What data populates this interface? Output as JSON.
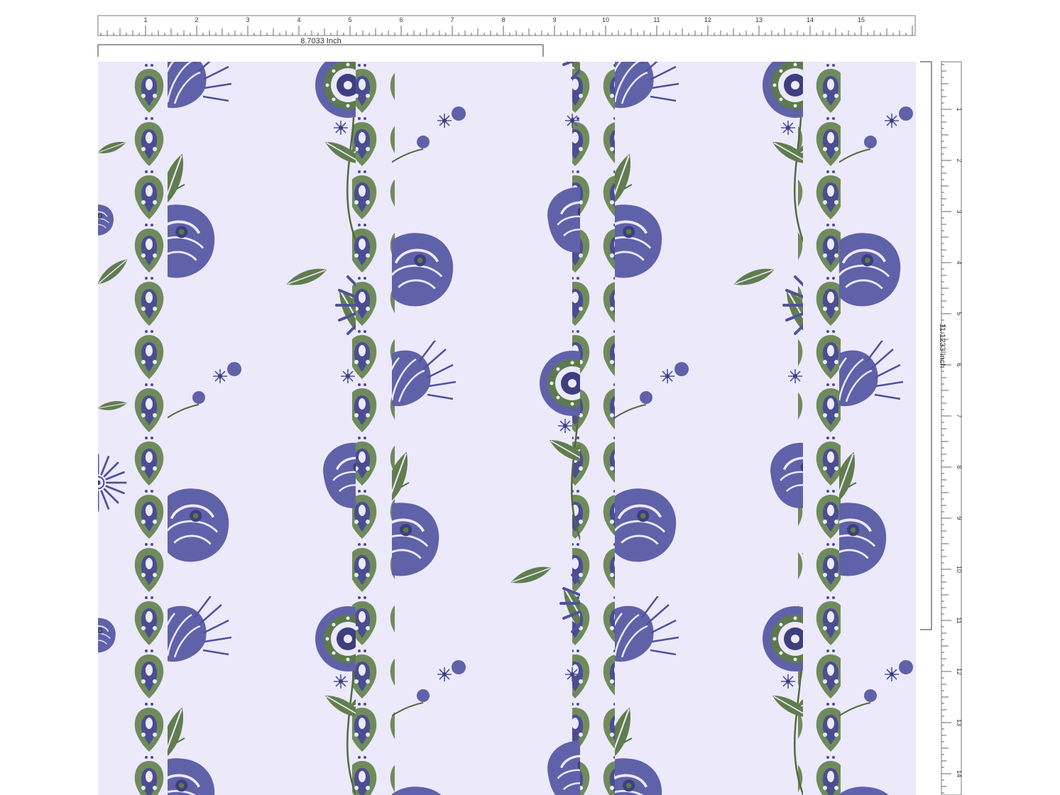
{
  "rulers": {
    "top_numbers": [
      "1",
      "2",
      "3",
      "4",
      "5",
      "6",
      "7",
      "8",
      "9",
      "10",
      "11",
      "12",
      "13",
      "14",
      "15"
    ],
    "right_numbers": [
      "1",
      "2",
      "3",
      "4",
      "5",
      "6",
      "7",
      "8",
      "9",
      "10",
      "11",
      "12",
      "13",
      "14"
    ]
  },
  "dimensions": {
    "width_label": "8.7033 Inch",
    "height_label": "11.1233 Inch"
  },
  "pattern": {
    "background": "#ECE9FB",
    "blue": "#5F62A8",
    "blue_dark": "#3D3F7E",
    "green": "#5D7A4C",
    "green_light": "#7E9A6A",
    "icon": "floral-block-print-pattern"
  }
}
